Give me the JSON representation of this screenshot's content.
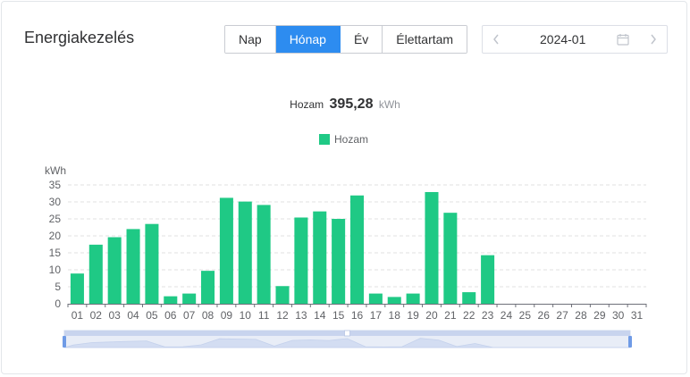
{
  "header": {
    "title": "Energiakezelés",
    "tabs": [
      {
        "label": "Nap",
        "active": false
      },
      {
        "label": "Hónap",
        "active": true
      },
      {
        "label": "Év",
        "active": false
      },
      {
        "label": "Élettartam",
        "active": false
      }
    ],
    "date_value": "2024-01",
    "prev_icon": "chevron-left-icon",
    "next_icon": "chevron-right-icon",
    "calendar_icon": "calendar-icon"
  },
  "summary": {
    "label": "Hozam",
    "value": "395,28",
    "unit": "kWh"
  },
  "colors": {
    "accent": "#2d8cf0",
    "bar": "#1fc985"
  },
  "chart_data": {
    "type": "bar",
    "categories": [
      "01",
      "02",
      "03",
      "04",
      "05",
      "06",
      "07",
      "08",
      "09",
      "10",
      "11",
      "12",
      "13",
      "14",
      "15",
      "16",
      "17",
      "18",
      "19",
      "20",
      "21",
      "22",
      "23",
      "24",
      "25",
      "26",
      "27",
      "28",
      "29",
      "30",
      "31"
    ],
    "series": [
      {
        "name": "Hozam",
        "values": [
          8.9,
          17.4,
          19.6,
          22.0,
          23.5,
          2.2,
          3.0,
          9.7,
          31.2,
          30.1,
          29.1,
          5.2,
          25.4,
          27.2,
          25.0,
          31.9,
          3.0,
          2.0,
          3.0,
          32.9,
          26.8,
          3.4,
          14.3,
          null,
          null,
          null,
          null,
          null,
          null,
          null,
          null
        ]
      }
    ],
    "ylabel": "kWh",
    "ylim": [
      0,
      35
    ],
    "yticks": [
      0,
      5,
      10,
      15,
      20,
      25,
      30,
      35
    ],
    "grid": true,
    "legend": "top-center",
    "has_datazoom": true
  }
}
